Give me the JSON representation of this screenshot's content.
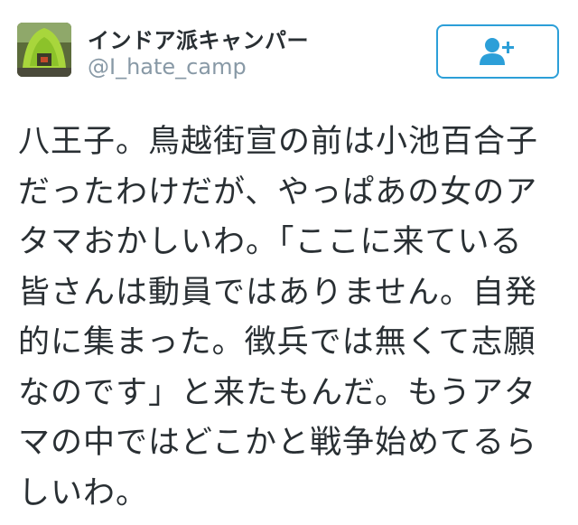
{
  "user": {
    "display_name": "インドア派キャンパー",
    "username": "@I_hate_camp",
    "avatar_icon": "tent-photo-avatar"
  },
  "follow_button": {
    "icon": "follow-user-plus-icon",
    "accent_color": "#2c9fd8"
  },
  "tweet": {
    "lines": [
      "八王子。鳥越街宣の前は小池百合子",
      "だったわけだが、やっぱあの女のア",
      "タマおかしいわ。「ここに来ている",
      "皆さんは動員ではありません。自発",
      "的に集まった。徴兵では無くて志願",
      "なのです」と来たもんだ。もうアタ",
      "マの中ではどこかと戦争始めてるら",
      "しいわ。"
    ]
  }
}
